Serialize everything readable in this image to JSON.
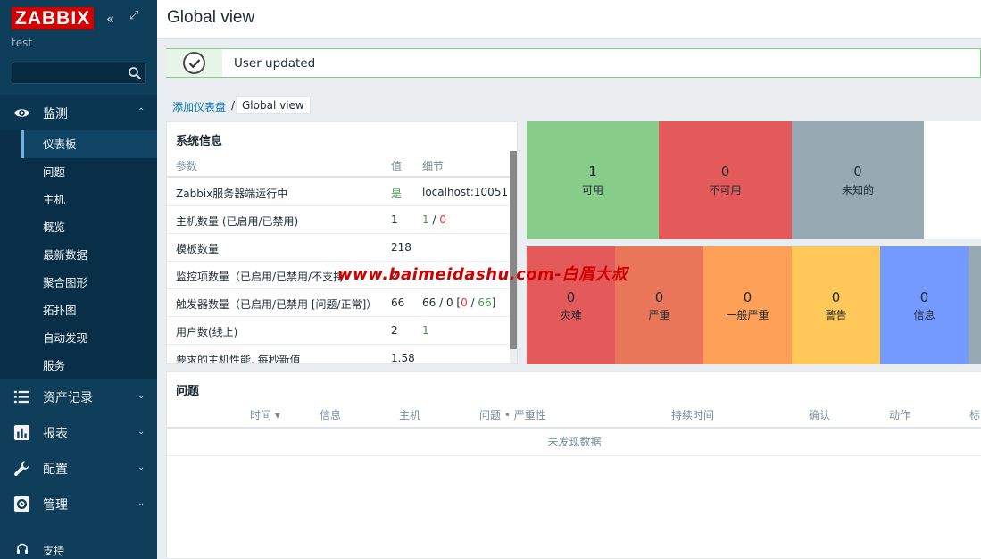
{
  "app": {
    "logo": "ZABBIX",
    "server_name": "test"
  },
  "sidebar": {
    "collapse_glyph": "«",
    "expand_glyph": "⤢",
    "search_placeholder": "",
    "sections": [
      {
        "label": "监测",
        "icon": "eye-icon",
        "open": true
      },
      {
        "label": "资产记录",
        "icon": "list-icon"
      },
      {
        "label": "报表",
        "icon": "bar-chart-icon"
      },
      {
        "label": "配置",
        "icon": "wrench-icon"
      },
      {
        "label": "管理",
        "icon": "gear-icon"
      }
    ],
    "monitoring_items": [
      "仪表板",
      "问题",
      "主机",
      "概览",
      "最新数据",
      "聚合图形",
      "拓扑图",
      "自动发现",
      "服务"
    ],
    "support_label": "支持",
    "chevron_up": "⌃",
    "chevron_down": "⌄"
  },
  "header": {
    "title": "Global view"
  },
  "message": {
    "text": "User updated"
  },
  "breadcrumb": {
    "parent": "添加仪表盘",
    "separator": "/",
    "current": "Global view"
  },
  "system_info": {
    "title": "系统信息",
    "columns": [
      "参数",
      "值",
      "细节"
    ],
    "rows": [
      {
        "param": "Zabbix服务器端运行中",
        "value": "是",
        "detail": "localhost:10051"
      },
      {
        "param": "主机数量 (已启用/已禁用)",
        "value": "1",
        "detail_a": "1",
        "detail_sep": " / ",
        "detail_b": "0"
      },
      {
        "param": "模板数量",
        "value": "218",
        "detail": ""
      },
      {
        "param": "监控项数量（已启用/已禁用/不支持）",
        "value": "2",
        "detail": ""
      },
      {
        "param": "触发器数量（已启用/已禁用 [问题/正常]）",
        "value": "66",
        "detail_a": "66 / 0 [",
        "detail_b": "0",
        "detail_sep": " / ",
        "detail_c": "66",
        "detail_end": "]"
      },
      {
        "param": "用户数(线上)",
        "value": "2",
        "detail": "1"
      },
      {
        "param": "要求的主机性能, 每秒新值",
        "value": "1.58",
        "detail": ""
      }
    ]
  },
  "host_availability": {
    "tiles": [
      {
        "count": "1",
        "label": "可用",
        "color": "#87cc88"
      },
      {
        "count": "0",
        "label": "不可用",
        "color": "#e45959"
      },
      {
        "count": "0",
        "label": "未知的",
        "color": "#97aab3"
      },
      {
        "count": "",
        "label": "",
        "color": "#ffffff"
      }
    ]
  },
  "severity": {
    "tiles": [
      {
        "count": "0",
        "label": "灾难",
        "color": "#e45959"
      },
      {
        "count": "0",
        "label": "严重",
        "color": "#e97659"
      },
      {
        "count": "0",
        "label": "一般严重",
        "color": "#ffa059"
      },
      {
        "count": "0",
        "label": "警告",
        "color": "#ffc859"
      },
      {
        "count": "0",
        "label": "信息",
        "color": "#7499ff"
      },
      {
        "count": "",
        "label": "",
        "color": "#97aab3"
      }
    ]
  },
  "problems": {
    "title": "问题",
    "columns": [
      "时间 ▾",
      "信息",
      "主机",
      "问题 • 严重性",
      "持续时间",
      "确认",
      "动作",
      "标"
    ],
    "empty": "未发现数据"
  },
  "watermark": {
    "text": "www.baimeidashu.com-白眉大叔"
  }
}
